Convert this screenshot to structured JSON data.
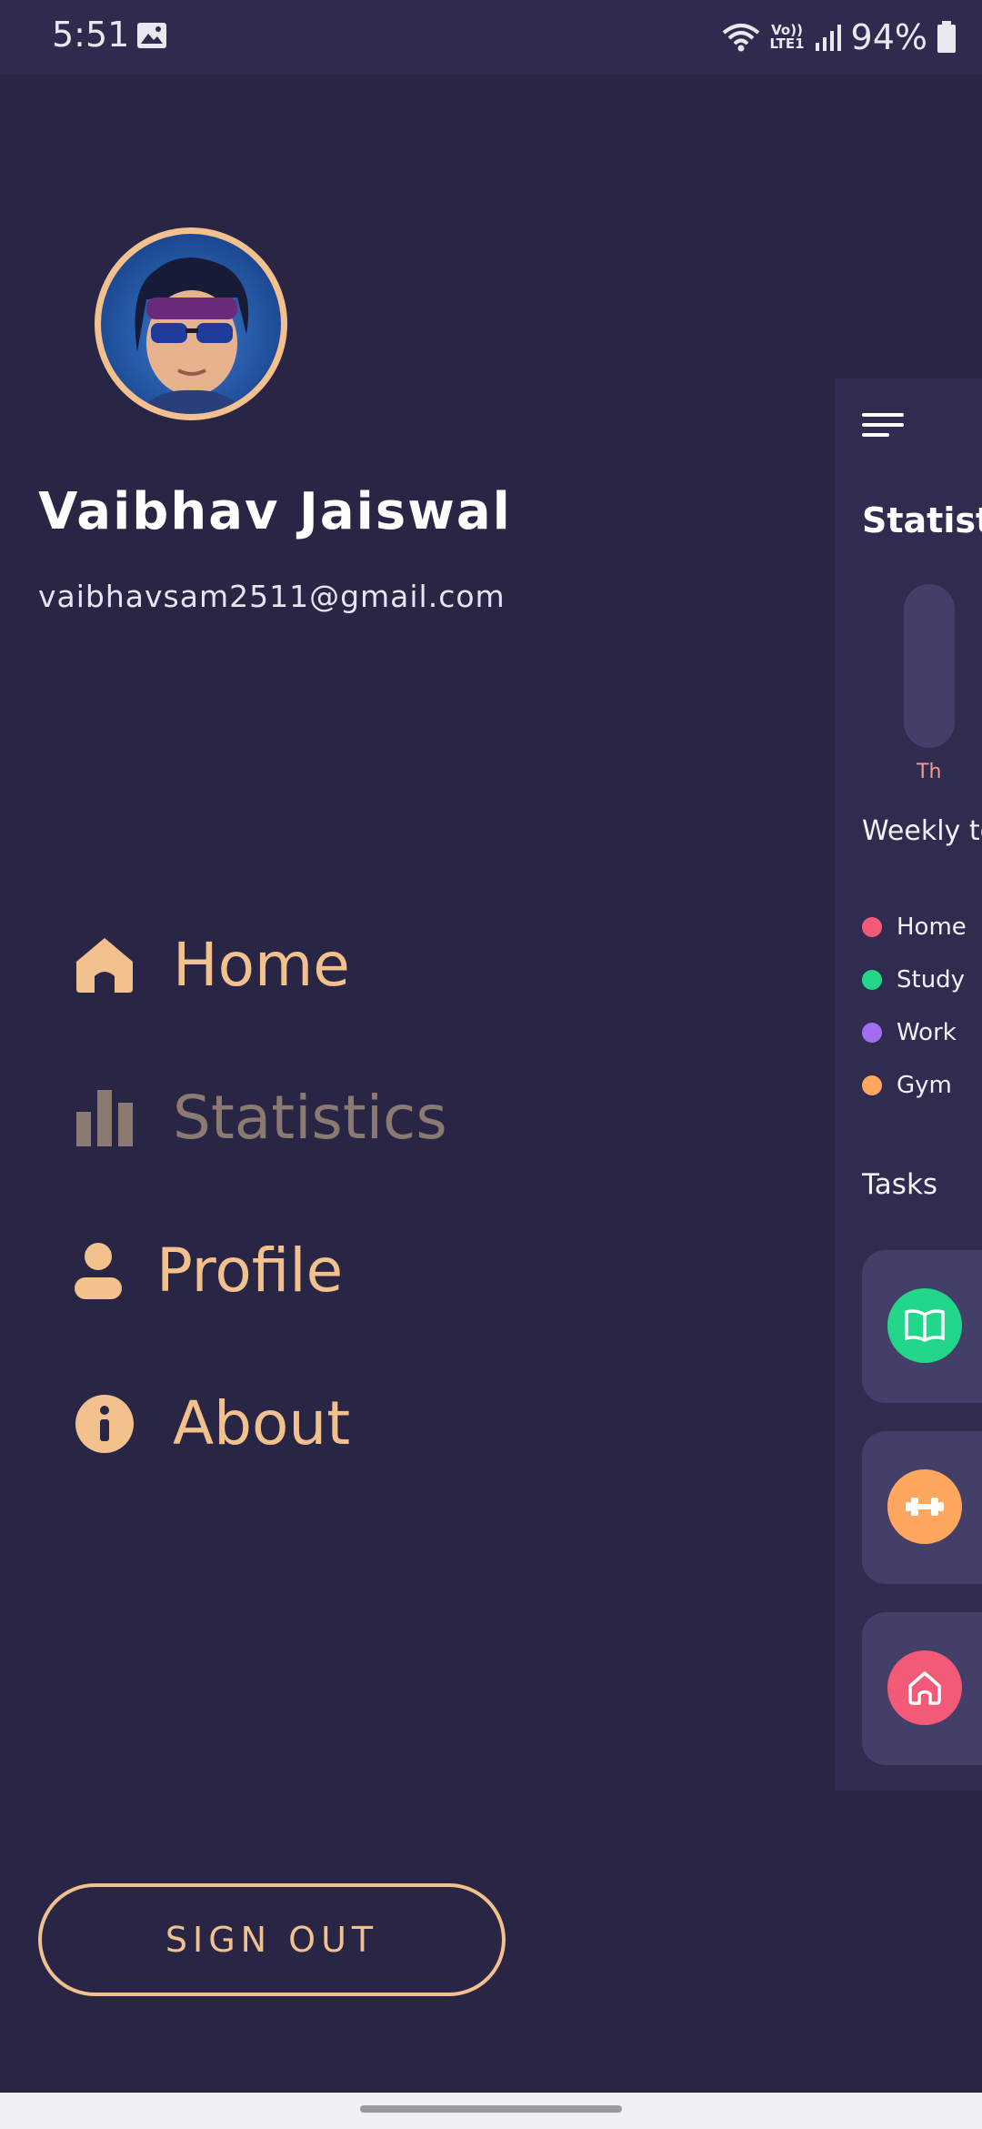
{
  "status_bar": {
    "time": "5:51",
    "network_label": "Vo)) LTE1",
    "battery": "94%"
  },
  "drawer": {
    "user": {
      "name": "Vaibhav Jaiswal",
      "email": "vaibhavsam2511@gmail.com"
    },
    "menu": [
      {
        "label": "Home",
        "icon": "home-icon",
        "active": false
      },
      {
        "label": "Statistics",
        "icon": "bar-chart-icon",
        "active": true
      },
      {
        "label": "Profile",
        "icon": "person-icon",
        "active": false
      },
      {
        "label": "About",
        "icon": "info-icon",
        "active": false
      }
    ],
    "sign_out_label": "SIGN OUT"
  },
  "main_panel": {
    "title": "Statisti",
    "bar_day_label": "Th",
    "weekly_label": "Weekly to",
    "legend": [
      {
        "label": "Home",
        "color": "#f25a78"
      },
      {
        "label": "Study",
        "color": "#22d68a"
      },
      {
        "label": "Work",
        "color": "#a46cf0"
      },
      {
        "label": "Gym",
        "color": "#ffa65f"
      }
    ],
    "tasks_label": "Tasks",
    "task_icons": [
      "book-icon",
      "dumbbell-icon",
      "home-icon"
    ]
  },
  "colors": {
    "background": "#292544",
    "accent": "#f2c18e",
    "panel": "#302c50"
  }
}
